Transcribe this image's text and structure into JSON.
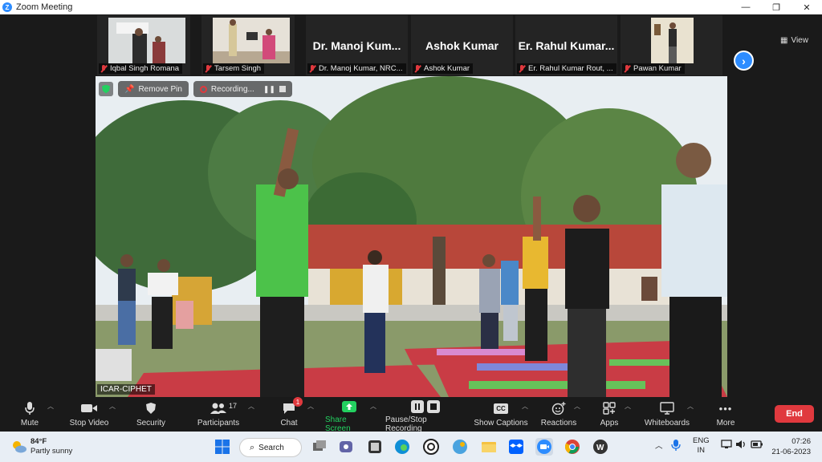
{
  "window": {
    "title": "Zoom Meeting",
    "minimize": "—",
    "restore": "❐",
    "close": "✕"
  },
  "thumbnails": [
    {
      "name": "Iqbal Singh Romana",
      "type": "video"
    },
    {
      "name": "Tarsem Singh",
      "type": "video"
    },
    {
      "name": "Dr. Manoj Kumar, NRC...",
      "big_name": "Dr. Manoj Kum...",
      "type": "name"
    },
    {
      "name": "Ashok Kumar",
      "big_name": "Ashok Kumar",
      "type": "name"
    },
    {
      "name": "Er. Rahul Kumar Rout, ...",
      "big_name": "Er. Rahul Kumar...",
      "type": "name"
    },
    {
      "name": "Pawan Kumar",
      "type": "video"
    }
  ],
  "view_button": "View",
  "main": {
    "remove_pin": "Remove Pin",
    "recording": "Recording...",
    "speaker_label": "ICAR-CIPHET"
  },
  "toolbar": {
    "mute": "Mute",
    "stop_video": "Stop Video",
    "security": "Security",
    "participants": "Participants",
    "participants_count": "17",
    "chat": "Chat",
    "chat_badge": "1",
    "share_screen": "Share Screen",
    "pause_recording": "Pause/Stop Recording",
    "show_captions": "Show Captions",
    "captions_icon_text": "CC",
    "reactions": "Reactions",
    "apps": "Apps",
    "whiteboards": "Whiteboards",
    "more": "More",
    "more_icon_text": "•••",
    "end": "End"
  },
  "taskbar": {
    "temperature": "84°F",
    "weather": "Partly sunny",
    "search": "Search",
    "language_line1": "ENG",
    "language_line2": "IN",
    "time": "07:26",
    "date": "21-06-2023"
  },
  "colors": {
    "zoom_blue": "#2d8cff",
    "end_red": "#e0393e",
    "share_green": "#23d160"
  }
}
